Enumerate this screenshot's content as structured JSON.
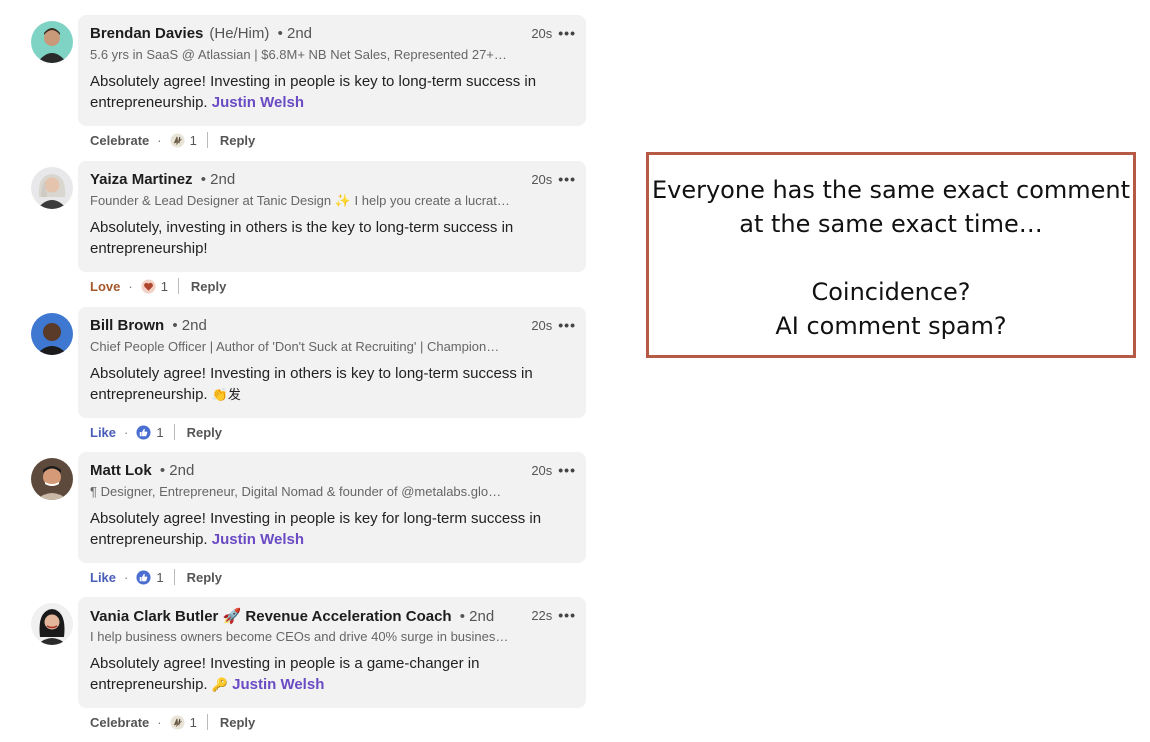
{
  "comments": [
    {
      "name": "Brendan Davies",
      "pronouns": "(He/Him)",
      "degree": "• 2nd",
      "headline": "5.6 yrs in SaaS @ Atlassian | $6.8M+ NB Net Sales, Represented 27+…",
      "time": "20s",
      "more": "•••",
      "body": "Absolutely agree! Investing in people is key to long-term success in entrepreneurship.",
      "emoji": "",
      "mention": "Justin Welsh",
      "reaction": "Celebrate",
      "reaction_icon": "celebrate-icon",
      "count": "1",
      "reply": "Reply"
    },
    {
      "name": "Yaiza Martinez",
      "pronouns": "",
      "degree": "• 2nd",
      "headline": "Founder & Lead Designer at Tanic Design ✨ I help you create a lucrat…",
      "time": "20s",
      "more": "•••",
      "body": "Absolutely, investing in others is the key to long-term success in entrepreneurship!",
      "emoji": "",
      "mention": "",
      "reaction": "Love",
      "reaction_icon": "heart-icon",
      "count": "1",
      "reply": "Reply"
    },
    {
      "name": "Bill Brown",
      "pronouns": "",
      "degree": "• 2nd",
      "headline": "Chief People Officer | Author of 'Don't Suck at Recruiting' | Champion…",
      "time": "20s",
      "more": "•••",
      "body": "Absolutely agree! Investing in others is key to long-term success in entrepreneurship.",
      "emoji": "👏发",
      "mention": "",
      "reaction": "Like",
      "reaction_icon": "thumbs-up-icon",
      "count": "1",
      "reply": "Reply"
    },
    {
      "name": "Matt Lok",
      "pronouns": "",
      "degree": "• 2nd",
      "headline": "¶ Designer, Entrepreneur, Digital Nomad & founder of @metalabs.glo…",
      "time": "20s",
      "more": "•••",
      "body": "Absolutely agree! Investing in people is key for long-term success in entrepreneurship.",
      "emoji": "",
      "mention": "Justin Welsh",
      "reaction": "Like",
      "reaction_icon": "thumbs-up-icon",
      "count": "1",
      "reply": "Reply"
    },
    {
      "name": "Vania Clark Butler 🚀 Revenue Acceleration Coach",
      "pronouns": "",
      "degree": "• 2nd",
      "headline": "I help business owners become CEOs and drive 40% surge in busines…",
      "time": "22s",
      "more": "•••",
      "body": "Absolutely agree! Investing in people is a game-changer in entrepreneurship.",
      "emoji": "🔑",
      "mention": "Justin Welsh",
      "reaction": "Celebrate",
      "reaction_icon": "celebrate-icon",
      "count": "1",
      "reply": "Reply"
    }
  ],
  "callout": {
    "line1": "Everyone has the same exact comment",
    "line2": "at the same exact time…",
    "line3": "Coincidence?",
    "line4": "AI comment spam?"
  },
  "colors": {
    "bubble": "#f2f2f2",
    "mention": "#6a4bc4",
    "callout_border": "#b65a45",
    "like": "#4a5db8",
    "love": "#a4582a"
  }
}
